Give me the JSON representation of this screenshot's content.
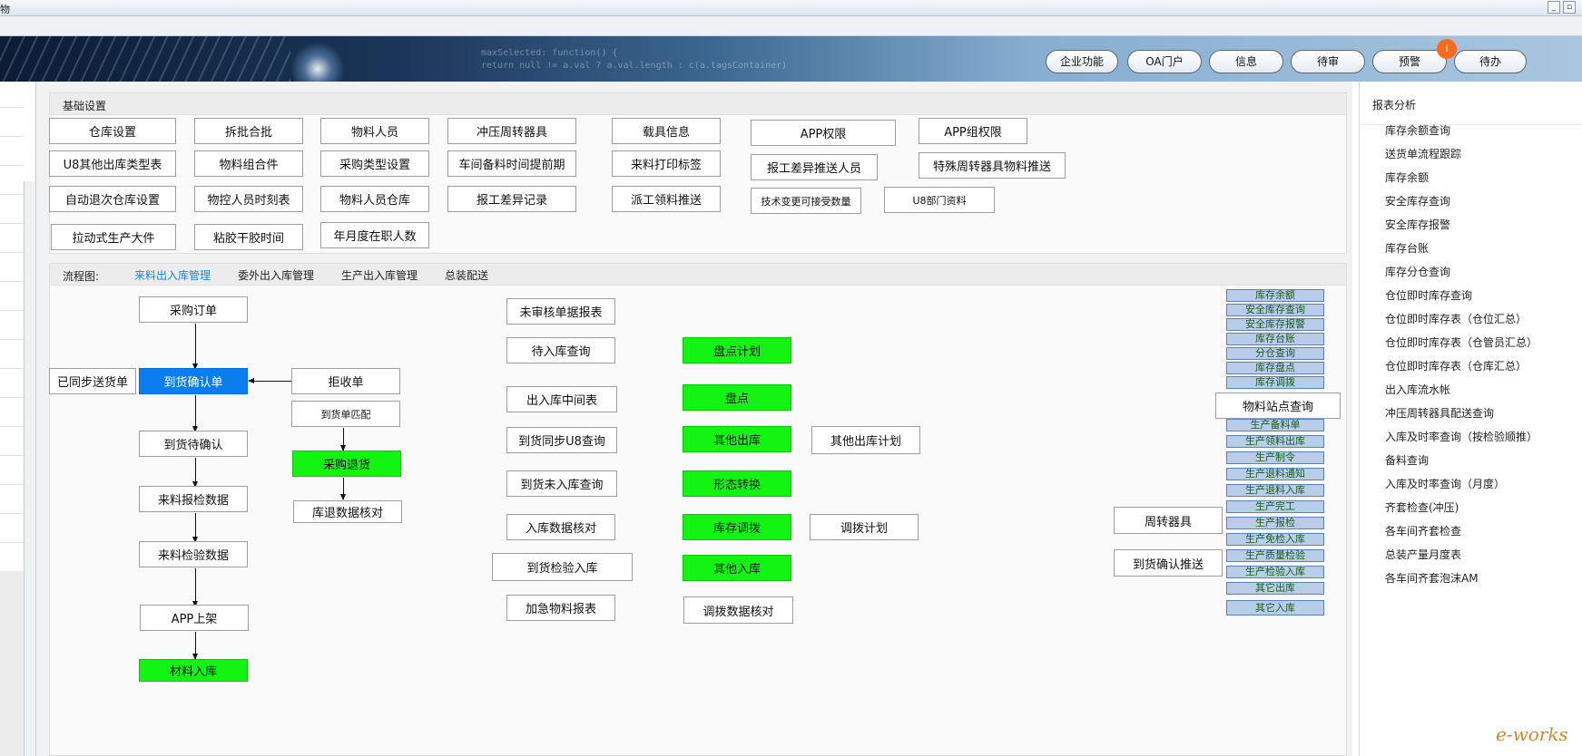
{
  "window": {
    "title": "物"
  },
  "topnav": [
    {
      "label": "企业功能"
    },
    {
      "label": "OA门户"
    },
    {
      "label": "信息"
    },
    {
      "label": "待审"
    },
    {
      "label": "预警"
    },
    {
      "label": "待办"
    }
  ],
  "badge": {
    "value": "i",
    "color": "#ff6a1a"
  },
  "banner": {
    "code_line1": "maxSelected: function() {",
    "code_line2": "return null != a.val ? a.val.length : c(a.tagsContainer)"
  },
  "basic_settings": {
    "title": "基础设置",
    "buttons": [
      "仓库设置",
      "拆批合批",
      "物料人员",
      "冲压周转器具",
      "载具信息",
      "APP权限",
      "APP组权限",
      "U8其他出库类型表",
      "物料组合件",
      "采购类型设置",
      "车间备料时间提前期",
      "来料打印标签",
      "报工差异推送人员",
      "特殊周转器具物料推送",
      "自动退次仓库设置",
      "物控人员时刻表",
      "物料人员仓库",
      "报工差异记录",
      "派工领料推送",
      "技术变更可接受数量",
      "U8部门资料",
      "拉动式生产大件",
      "粘胶干胶时间",
      "年月度在职人数"
    ]
  },
  "flow": {
    "label": "流程图:",
    "tabs": [
      "来料出入库管理",
      "委外出入库管理",
      "生产出入库管理",
      "总装配送"
    ],
    "main_chain": [
      "采购订单",
      "到货确认单",
      "到货待确认",
      "来料报检数据",
      "来料检验数据",
      "APP上架",
      "材料入库"
    ],
    "side_left": "已同步送货单",
    "reject": [
      "拒收单",
      "到货单匹配",
      "采购退货",
      "库退数据核对"
    ],
    "reports": [
      "未审核单据报表",
      "待入库查询",
      "出入库中间表",
      "到货同步U8查询",
      "到货未入库查询",
      "入库数据核对",
      "到货检验入库",
      "加急物料报表"
    ],
    "green_ops": [
      "盘点计划",
      "盘点",
      "其他出库",
      "形态转换",
      "库存调拨",
      "其他入库"
    ],
    "plans": [
      "其他出库计划",
      "调拨计划",
      "调拨数据核对"
    ],
    "station_query": "物料站点查询",
    "stock_reports_top": [
      "库存余额",
      "安全库存查询",
      "安全库存报警",
      "库存台账",
      "分仓查询",
      "库存盘点",
      "库存调拨"
    ],
    "stock_reports_bottom": [
      "生产备料单",
      "生产领料出库",
      "生产制令",
      "生产退料通知",
      "生产退料入库",
      "生产完工",
      "生产报检",
      "生产免检入库",
      "生产质量检验",
      "生产检验入库",
      "其它出库",
      "其它入库"
    ],
    "right_buttons": [
      "周转器具",
      "到货确认推送"
    ]
  },
  "report_analysis": {
    "title": "报表分析",
    "items": [
      "库存余额查询",
      "送货单流程跟踪",
      "库存余额",
      "安全库存查询",
      "安全库存报警",
      "库存台账",
      "库存分仓查询",
      "仓位即时库存查询",
      "仓位即时库存表（仓位汇总）",
      "仓位即时库存表（仓管员汇总）",
      "仓位即时库存表（仓库汇总）",
      "出入库流水帐",
      "冲压周转器具配送查询",
      "入库及时率查询（按检验顺推）",
      "备料查询",
      "入库及时率查询（月度）",
      "齐套检查(冲压)",
      "各车间齐套检查",
      "总装产量月度表",
      "各车间齐套泡沫AM"
    ]
  },
  "watermark": "e-works",
  "colors": {
    "accent_blue": "#0a7ef0",
    "op_green": "#12f512",
    "report_blue": "#b7cde8",
    "report_text": "#1c5a1c"
  }
}
